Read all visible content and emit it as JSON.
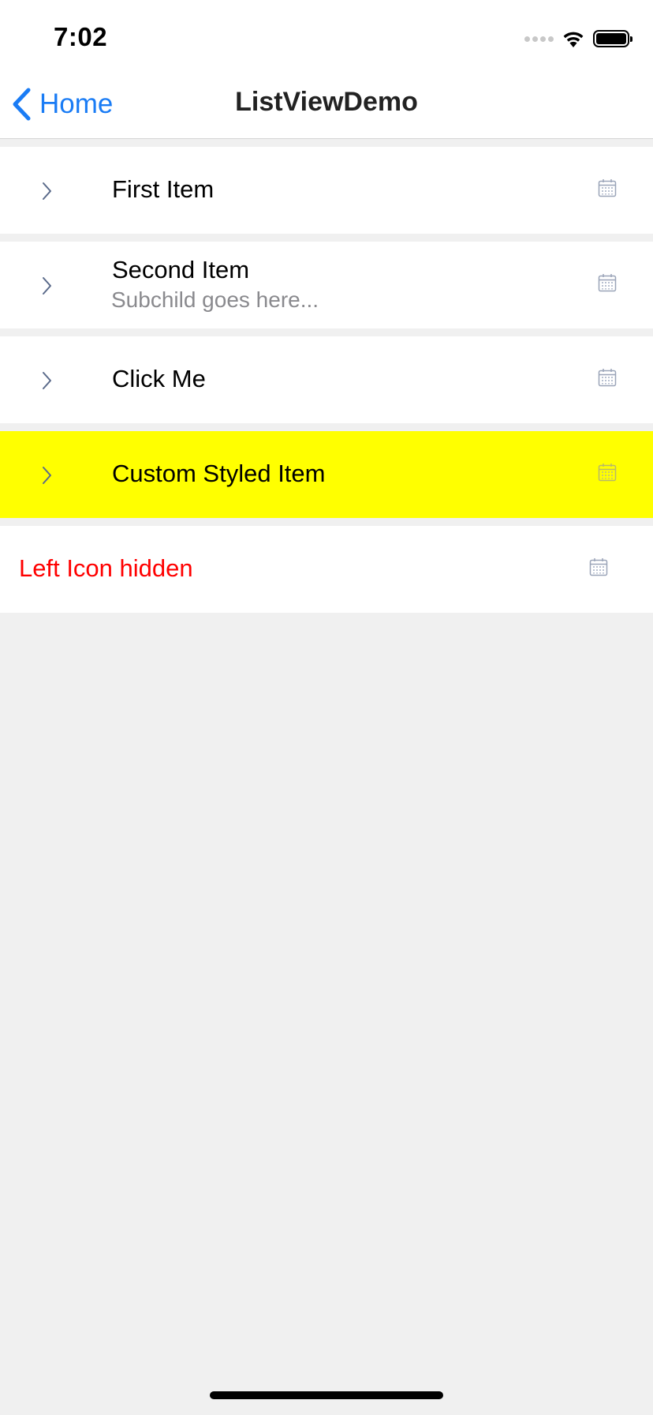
{
  "status_bar": {
    "time": "7:02"
  },
  "nav": {
    "back_label": "Home",
    "title": "ListViewDemo"
  },
  "colors": {
    "accent": "#1a7cf5",
    "highlight_bg": "#ffff00",
    "danger_text": "#ff0000"
  },
  "items": [
    {
      "title": "First Item",
      "left_icon": "chevron-right-icon",
      "right_icon": "calendar-icon"
    },
    {
      "title": "Second Item",
      "subtitle": "Subchild goes here...",
      "left_icon": "chevron-right-icon",
      "right_icon": "calendar-icon"
    },
    {
      "title": "Click Me",
      "left_icon": "chevron-right-icon",
      "right_icon": "calendar-icon"
    },
    {
      "title": "Custom Styled Item",
      "left_icon": "chevron-right-icon",
      "right_icon": "calendar-icon",
      "background": "#ffff00"
    },
    {
      "title": "Left Icon hidden",
      "right_icon": "calendar-icon",
      "text_color": "#ff0000"
    }
  ]
}
